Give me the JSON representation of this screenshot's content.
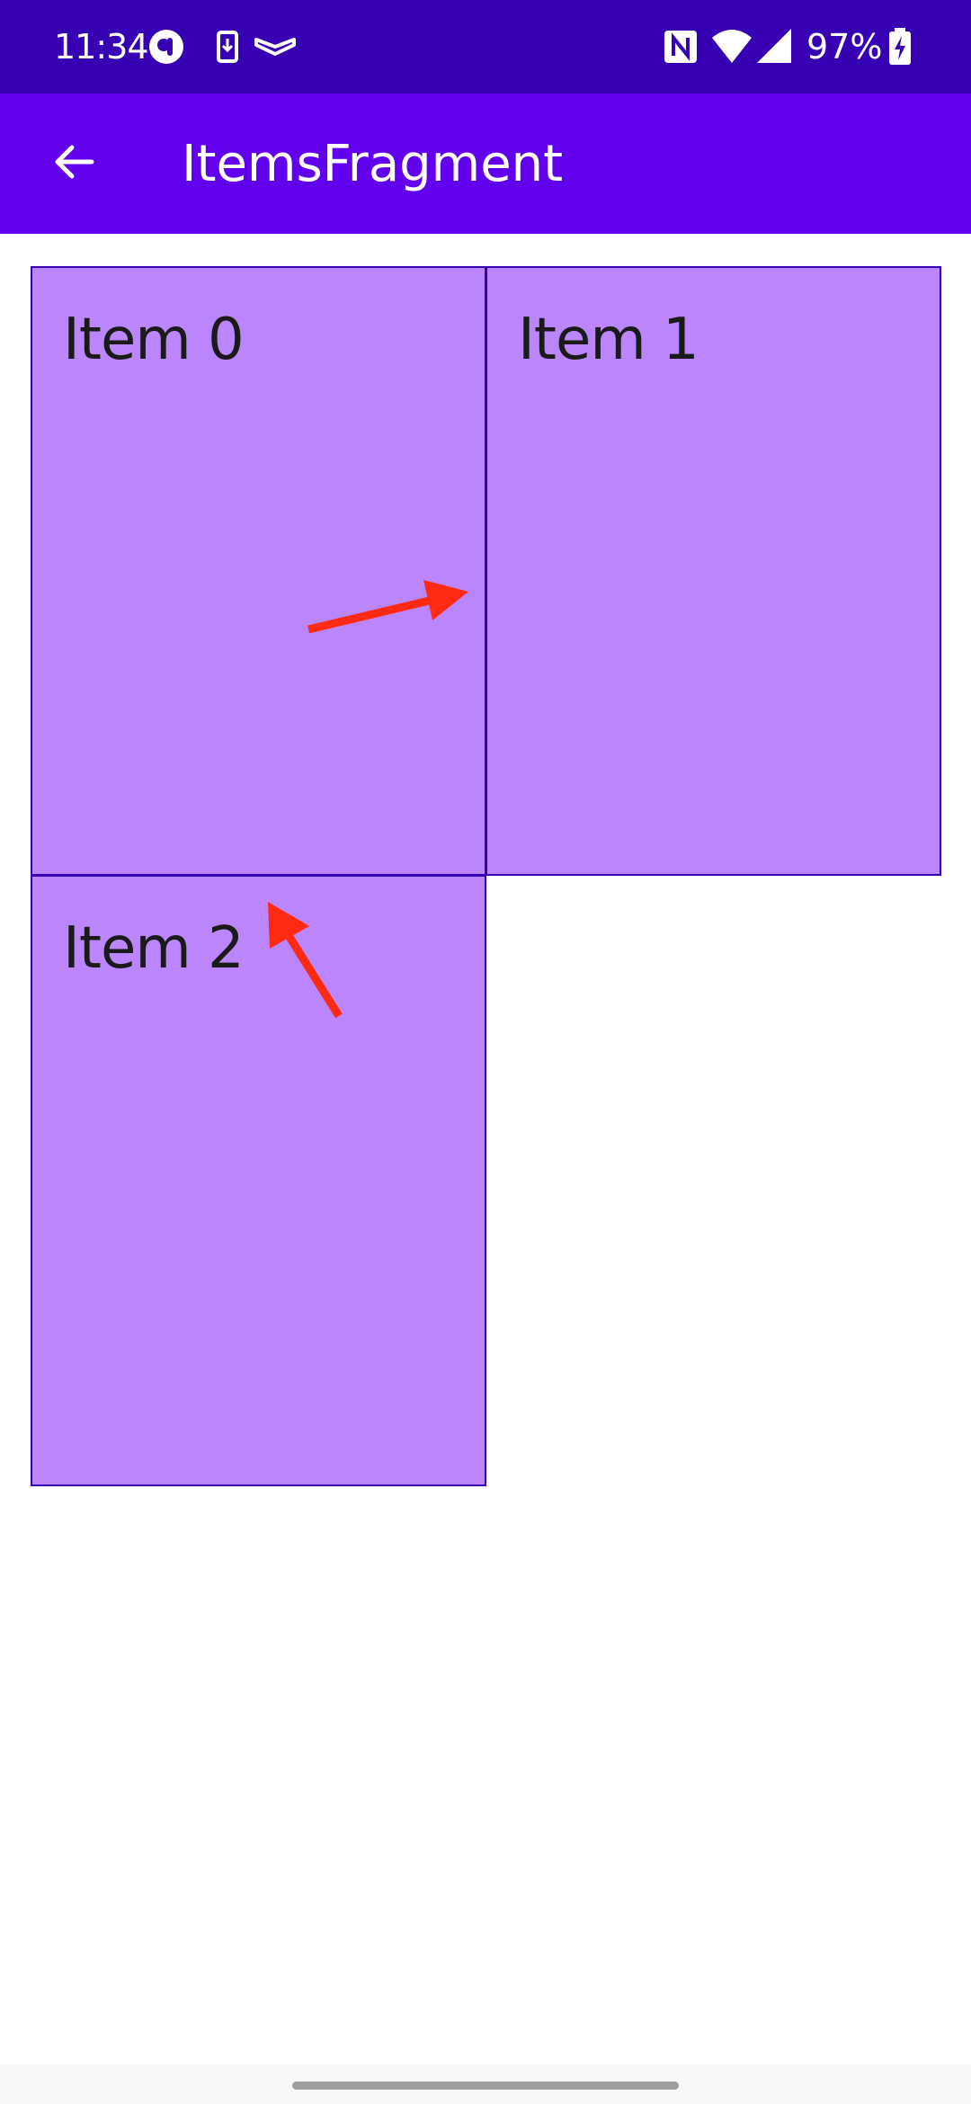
{
  "status_bar": {
    "time": "11:34",
    "battery_percent": "97%",
    "icons": [
      "pocket-app-icon",
      "download-notification-icon",
      "vpn-icon",
      "nfc-icon",
      "wifi-icon",
      "cell-signal-icon",
      "battery-charging-icon"
    ]
  },
  "app_bar": {
    "title": "ItemsFragment",
    "back_icon": "arrow-back-icon"
  },
  "items": [
    {
      "label": "Item 0"
    },
    {
      "label": "Item 1"
    },
    {
      "label": "Item 2"
    }
  ],
  "colors": {
    "status_bar": "#3700b3",
    "app_bar": "#6200ee",
    "item_fill": "#bb86fc",
    "item_border": "#3700b3",
    "annotation_arrow": "#ff2a12"
  }
}
